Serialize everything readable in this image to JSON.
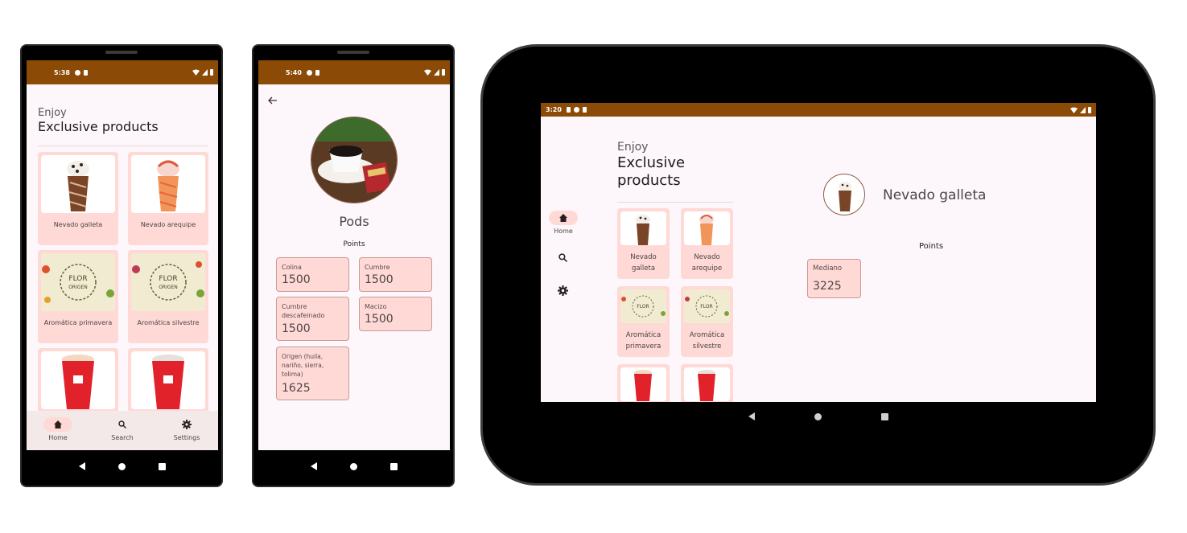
{
  "phone1": {
    "time": "5:38",
    "enjoy": "Enjoy",
    "title": "Exclusive products",
    "products": [
      "Nevado galleta",
      "Nevado arequipe",
      "Aromática primavera",
      "Aromática silvestre"
    ],
    "nav": [
      "Home",
      "Search",
      "Settings"
    ]
  },
  "phone2": {
    "time": "5:40",
    "product_name": "Pods",
    "points_label": "Points",
    "points": [
      {
        "name": "Colina",
        "value": "1500"
      },
      {
        "name": "Cumbre",
        "value": "1500"
      },
      {
        "name": "Cumbre descafeinado",
        "value": "1500"
      },
      {
        "name": "Macizo",
        "value": "1500"
      },
      {
        "name": "Origen (huila, nariño, sierra, tolima)",
        "value": "1625"
      }
    ]
  },
  "tablet": {
    "time": "3:20",
    "enjoy": "Enjoy",
    "title": "Exclusive products",
    "products": [
      "Nevado galleta",
      "Nevado arequipe",
      "Aromática primavera",
      "Aromática silvestre"
    ],
    "rail": [
      "Home"
    ],
    "detail_name": "Nevado galleta",
    "points_label": "Points",
    "points": [
      {
        "name": "Mediano",
        "value": "3225"
      }
    ]
  },
  "colors": {
    "status_bar": "#8b4a05",
    "card": "#ffd9d6",
    "background": "#fdf7fb"
  }
}
